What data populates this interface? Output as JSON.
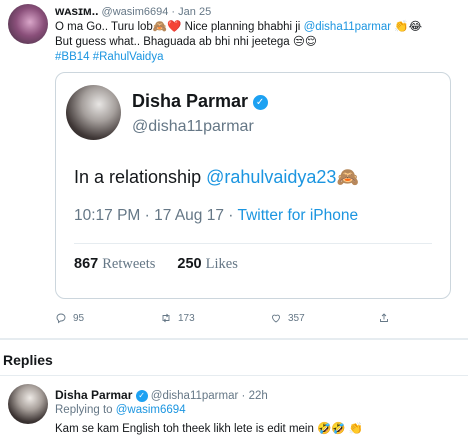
{
  "tweet": {
    "display_name": "ᴡᴀsɪᴍ..",
    "handle": "@wasim6694",
    "dot": "·",
    "date": "Jan 25",
    "text_line1_a": "O ma Go.. Turu lob",
    "emoji_monkey": "🙈",
    "emoji_heart": "❤️",
    "text_line1_b": " Nice planning bhabhi ji ",
    "mention_disha": "@disha11parmar",
    "emoji_clap": "👏",
    "emoji_cry": "😂",
    "text_line2": "But guess what.. Bhaguada ab bhi nhi jeetega ",
    "emoji_unamused": "😒😌",
    "hashtags": "#BB14 #RahulVaidya",
    "actions": {
      "replies": "95",
      "retweets": "173",
      "likes": "357"
    }
  },
  "quoted": {
    "display_name": "Disha Parmar",
    "handle": "@disha11parmar",
    "text": "In a relationship ",
    "mention": "@rahulvaidya23",
    "emoji": "🙈",
    "time": "10:17 PM",
    "dot": "·",
    "date": "17 Aug 17",
    "dot2": "·",
    "source": "Twitter for iPhone",
    "retweet_count": "867",
    "retweet_label": "Retweets",
    "like_count": "250",
    "like_label": "Likes"
  },
  "replies_section": {
    "heading": "Replies"
  },
  "reply": {
    "display_name": "Disha Parmar",
    "handle": "@disha11parmar",
    "dot": "·",
    "time": "22h",
    "replying_to_label": "Replying to",
    "replying_to_handle": "@wasim6694",
    "text": "Kam se kam English toh theek likh lete is edit mein ",
    "emojis": "🤣🤣 👏"
  },
  "colors": {
    "link": "#1b95e0",
    "verified": "#1da1f2",
    "muted": "#657786",
    "border": "#ccd6dd"
  }
}
